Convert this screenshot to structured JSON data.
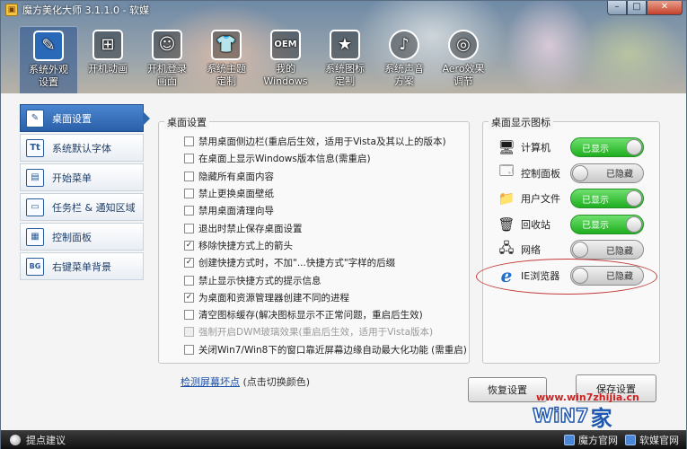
{
  "window": {
    "title": "魔方美化大师 3.1.1.0 - 软媒",
    "logo_glyph": "▣",
    "minimize": "–",
    "maximize": "□",
    "close": "✕"
  },
  "topnav": [
    {
      "label": "系统外观\n设置",
      "icon": "brush-icon",
      "glyph": "✎",
      "active": true
    },
    {
      "label": "开机动画",
      "icon": "windows-icon",
      "glyph": "⊞",
      "active": false
    },
    {
      "label": "开机登录\n画面",
      "icon": "user-icon",
      "glyph": "☺",
      "active": false
    },
    {
      "label": "系统主题\n定制",
      "icon": "shirt-icon",
      "glyph": "👕",
      "active": false
    },
    {
      "label": "我的\nWindows",
      "icon": "oem-icon",
      "glyph": "OEM",
      "active": false
    },
    {
      "label": "系统图标\n定制",
      "icon": "star-icon",
      "glyph": "★",
      "active": false
    },
    {
      "label": "系统声音\n方案",
      "icon": "music-note-icon",
      "glyph": "♪",
      "active": false
    },
    {
      "label": "Aero效果\n调节",
      "icon": "aero-disc-icon",
      "glyph": "◎",
      "active": false
    }
  ],
  "sidebar": [
    {
      "label": "桌面设置",
      "icon": "desktop-settings-icon",
      "glyph": "✎",
      "active": true
    },
    {
      "label": "系统默认字体",
      "icon": "font-icon",
      "glyph": "Tt",
      "active": false
    },
    {
      "label": "开始菜单",
      "icon": "start-menu-icon",
      "glyph": "▤",
      "active": false
    },
    {
      "label": "任务栏 & 通知区域",
      "icon": "taskbar-icon",
      "glyph": "▭",
      "active": false
    },
    {
      "label": "控制面板",
      "icon": "control-panel-icon",
      "glyph": "▦",
      "active": false
    },
    {
      "label": "右键菜单背景",
      "icon": "context-menu-icon",
      "glyph": "BG",
      "active": false
    }
  ],
  "desktop_settings": {
    "title": "桌面设置",
    "options": [
      {
        "label": "禁用桌面侧边栏(重启后生效，适用于Vista及其以上的版本)",
        "checked": false,
        "disabled": false
      },
      {
        "label": "在桌面上显示Windows版本信息(需重启)",
        "checked": false,
        "disabled": false
      },
      {
        "label": "隐藏所有桌面内容",
        "checked": false,
        "disabled": false
      },
      {
        "label": "禁止更换桌面壁纸",
        "checked": false,
        "disabled": false
      },
      {
        "label": "禁用桌面清理向导",
        "checked": false,
        "disabled": false
      },
      {
        "label": "退出时禁止保存桌面设置",
        "checked": false,
        "disabled": false
      },
      {
        "label": "移除快捷方式上的箭头",
        "checked": true,
        "disabled": false
      },
      {
        "label": "创建快捷方式时，不加\"...快捷方式\"字样的后缀",
        "checked": true,
        "disabled": false
      },
      {
        "label": "禁止显示快捷方式的提示信息",
        "checked": false,
        "disabled": false
      },
      {
        "label": "为桌面和资源管理器创建不同的进程",
        "checked": true,
        "disabled": false
      },
      {
        "label": "清空图标缓存(解决图标显示不正常问题，重启后生效)",
        "checked": false,
        "disabled": false
      },
      {
        "label": "强制开启DWM玻璃效果(重启后生效，适用于Vista版本)",
        "checked": false,
        "disabled": true
      },
      {
        "label": "关闭Win7/Win8下的窗口靠近屏幕边缘自动最大化功能 (需重启)",
        "checked": false,
        "disabled": false
      }
    ],
    "check_glyph": "✓"
  },
  "desktop_icons": {
    "title": "桌面显示图标",
    "items": [
      {
        "label": "计算机",
        "state": "已显示",
        "on": true,
        "icon": "computer-icon",
        "glyph": "🖥"
      },
      {
        "label": "控制面板",
        "state": "已隐藏",
        "on": false,
        "icon": "control-panel-icon",
        "glyph": "🗔"
      },
      {
        "label": "用户文件",
        "state": "已显示",
        "on": true,
        "icon": "user-folder-icon",
        "glyph": "📁"
      },
      {
        "label": "回收站",
        "state": "已显示",
        "on": true,
        "icon": "recycle-bin-icon",
        "glyph": "🗑"
      },
      {
        "label": "网络",
        "state": "已隐藏",
        "on": false,
        "icon": "network-icon",
        "glyph": "🖧"
      },
      {
        "label": "IE浏览器",
        "state": "已隐藏",
        "on": false,
        "icon": "ie-browser-icon",
        "glyph": "ℯ"
      }
    ]
  },
  "footer": {
    "link": "检测屏幕坏点",
    "link_hint": "(点击切换颜色)",
    "restore_button": "恢复设置",
    "save_button": "保存设置"
  },
  "watermark": {
    "url": "www.win7zhijia.cn",
    "brand": "WiN7",
    "home": "家"
  },
  "statusbar": {
    "left": "提点建议",
    "links": [
      "魔方官网",
      "软媒官网"
    ]
  },
  "colors": {
    "accent": "#2a60a8",
    "toggle_on": "#1fae1f",
    "highlight": "#c43a3a",
    "watermark_red": "#d02020",
    "watermark_blue": "#1e58b0"
  }
}
